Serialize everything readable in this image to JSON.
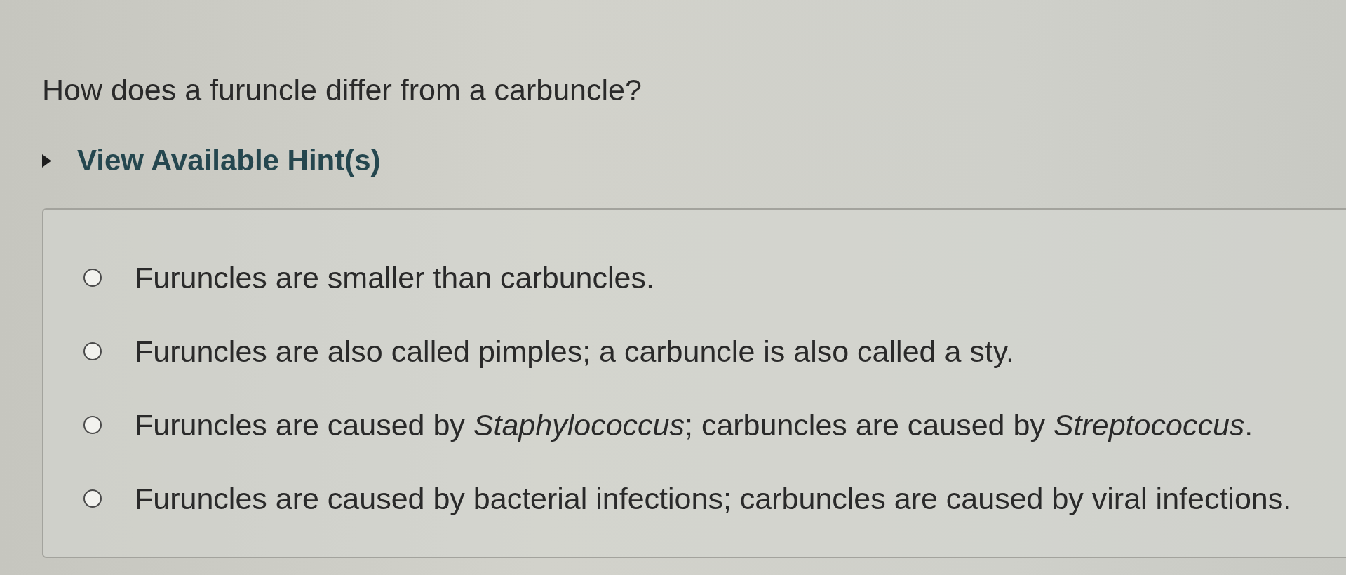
{
  "question": "How does a furuncle differ from a carbuncle?",
  "hint_toggle": {
    "label": "View Available Hint(s)",
    "expanded": false
  },
  "options": [
    {
      "text": "Furuncles are smaller than carbuncles.",
      "selected": false
    },
    {
      "text": "Furuncles are also called pimples; a carbuncle is also called a sty.",
      "selected": false
    },
    {
      "text": "Furuncles are caused by *Staphylococcus*; carbuncles are caused by *Streptococcus*.",
      "selected": false
    },
    {
      "text": "Furuncles are caused by bacterial infections; carbuncles are caused by viral infections.",
      "selected": false
    }
  ]
}
